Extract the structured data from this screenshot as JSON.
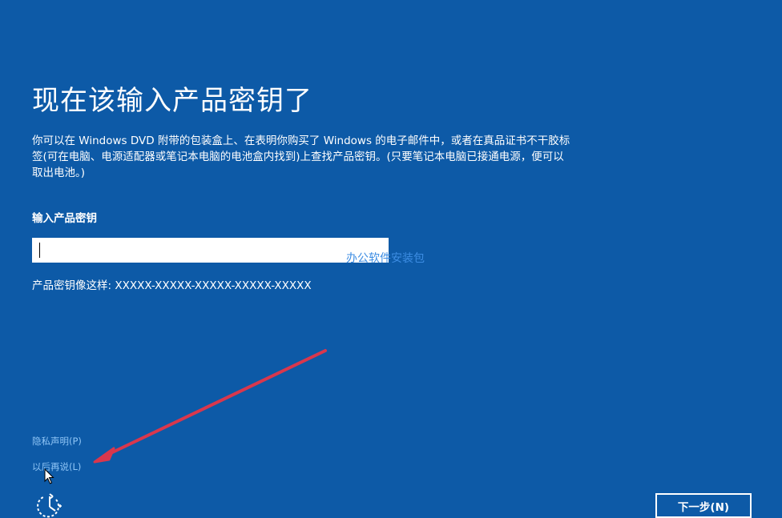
{
  "page": {
    "title": "现在该输入产品密钥了",
    "description": "你可以在 Windows DVD 附带的包装盒上、在表明你购买了 Windows 的电子邮件中，或者在真品证书不干胶标签(可在电脑、电源适配器或笔记本电脑的电池盒内找到)上查找产品密钥。(只要笔记本电脑已接通电源，便可以取出电池。)",
    "field_label": "输入产品密钥",
    "key_value": "",
    "key_example": "产品密钥像这样: XXXXX-XXXXX-XXXXX-XXXXX-XXXXX",
    "watermark": "办公软件安装包"
  },
  "footer": {
    "privacy_link": "隐私声明(P)",
    "later_link": "以后再说(L)",
    "next_button": "下一步(N)",
    "accessibility_icon": "ease-of-access-icon"
  },
  "colors": {
    "background": "#0d5aa7",
    "text": "#ffffff",
    "link": "#8fc5f6",
    "annotation_arrow": "#d9374d"
  }
}
